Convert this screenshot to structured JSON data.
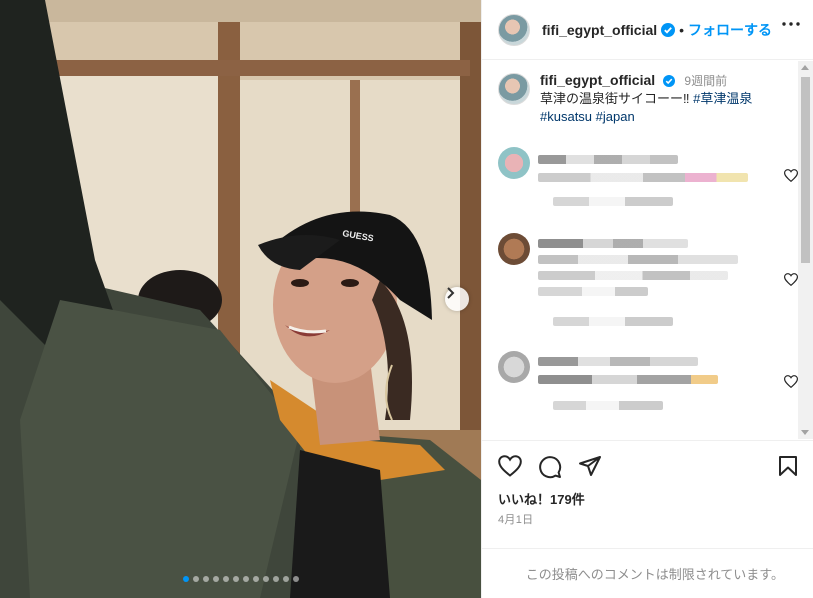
{
  "post": {
    "username": "fifi_egypt_official",
    "separator": "•",
    "follow_label": "フォローする",
    "caption": {
      "time_ago": "9週間前",
      "text": "草津の温泉街サイコーー‼",
      "hashtags": [
        "#草津温泉",
        "#kusatsu",
        "#japan"
      ]
    },
    "likes_text": "いいね！179件",
    "date": "4月1日",
    "comments_restricted": "この投稿へのコメントは制限されています。"
  },
  "carousel": {
    "dot_count": 12,
    "active_index": 0
  },
  "icons": {
    "verified": "verified-badge-icon",
    "more": "more-options-icon",
    "heart": "heart-icon",
    "comment": "comment-icon",
    "share": "share-icon",
    "save": "bookmark-icon",
    "next": "chevron-right-icon"
  },
  "colors": {
    "accent": "#0095f6",
    "hashtag": "#00376b",
    "muted": "#8e8e8e"
  }
}
